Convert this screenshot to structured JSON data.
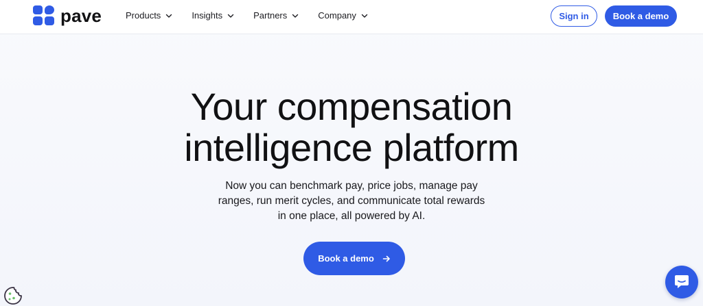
{
  "brand": {
    "name": "pave",
    "color": "#2f5be5"
  },
  "nav": {
    "items": [
      {
        "label": "Products"
      },
      {
        "label": "Insights"
      },
      {
        "label": "Partners"
      },
      {
        "label": "Company"
      }
    ],
    "sign_in": "Sign in",
    "book_demo": "Book a demo"
  },
  "hero": {
    "title_line1": "Your compensation",
    "title_line2": "intelligence platform",
    "subtitle": "Now you can benchmark pay, price jobs, manage pay ranges, run merit cycles, and communicate total rewards in one place, all powered by AI.",
    "cta": "Book a demo"
  },
  "icons": {
    "cookie": "cookie-icon",
    "chat": "chat-icon",
    "chevron": "chevron-down-icon",
    "arrow": "arrow-right-icon"
  }
}
